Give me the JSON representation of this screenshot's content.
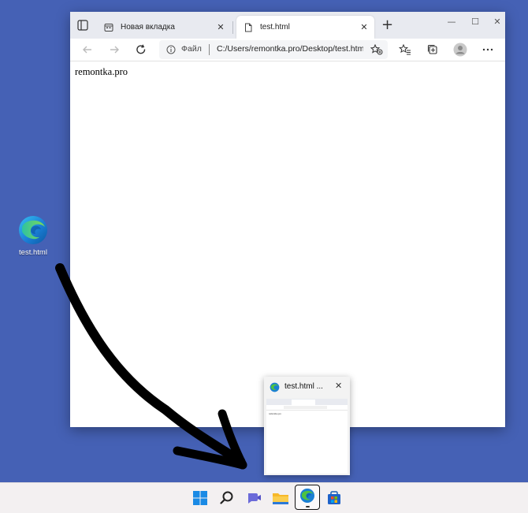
{
  "desktop": {
    "icon_label": "test.html"
  },
  "browser": {
    "tabs": [
      {
        "title": "Новая вкладка",
        "icon": "new-tab-icon"
      },
      {
        "title": "test.html",
        "icon": "file-icon"
      }
    ],
    "address_scheme_label": "Файл",
    "address_url": "C:/Users/remontka.pro/Desktop/test.html",
    "page_text": "remontka.pro",
    "window_controls": [
      "minimize",
      "maximize",
      "close"
    ]
  },
  "preview": {
    "title": "test.html ...",
    "mini_text": "remontka.pro"
  },
  "taskbar": {
    "items": [
      "start-icon",
      "search-icon",
      "chat-icon",
      "file-explorer-icon",
      "edge-icon",
      "store-icon"
    ]
  },
  "colors": {
    "desktop_bg": "#4561b5",
    "edge_blue": "#1a7fd4",
    "edge_green": "#4fc33f",
    "arrow": "#000000"
  }
}
